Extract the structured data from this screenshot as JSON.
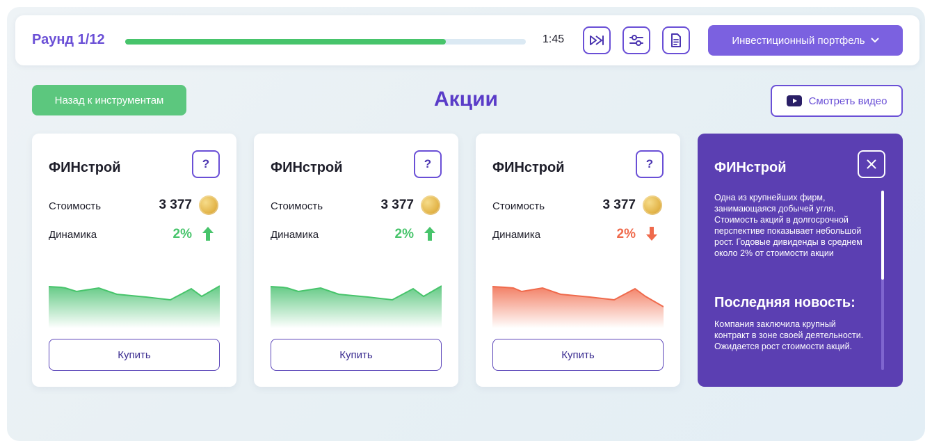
{
  "topbar": {
    "round_label": "Раунд 1/12",
    "round_progress": 0.8,
    "timer": "1:45",
    "fast_forward_icon": "fast-forward-icon",
    "settings_icon": "sliders-icon",
    "document_icon": "document-icon",
    "portfolio_label": "Инвестиционный портфель"
  },
  "header": {
    "back_label": "Назад к инструментам",
    "title": "Акции",
    "video_label": "Смотреть видео"
  },
  "cards": [
    {
      "title": "ФИНстрой",
      "help": "?",
      "price_label": "Стоимость",
      "price": "3 377",
      "change_label": "Динамика",
      "change": "2%",
      "trend": "up",
      "buy_label": "Купить"
    },
    {
      "title": "ФИНстрой",
      "help": "?",
      "price_label": "Стоимость",
      "price": "3 377",
      "change_label": "Динамика",
      "change": "2%",
      "trend": "up",
      "buy_label": "Купить"
    },
    {
      "title": "ФИНстрой",
      "help": "?",
      "price_label": "Стоимость",
      "price": "3 377",
      "change_label": "Динамика",
      "change": "2%",
      "trend": "down",
      "buy_label": "Купить"
    }
  ],
  "info_panel": {
    "title": "ФИНстрой",
    "description": "Одна из крупнейших фирм, занимающаяся добычей угля. Стоимость акций в долгосрочной перспективе показывает небольшой рост. Годовые дивиденды в среднем около 2% от стоимости акции",
    "news_heading": "Последняя новость:",
    "news_text": "Компания заключила крупный контракт в зоне своей деятельности. Ожидается рост стоимости акций."
  },
  "colors": {
    "accent": "#6a4fd6",
    "positive": "#47c46b",
    "negative": "#ef6a4c",
    "panel": "#5b3fb2"
  }
}
